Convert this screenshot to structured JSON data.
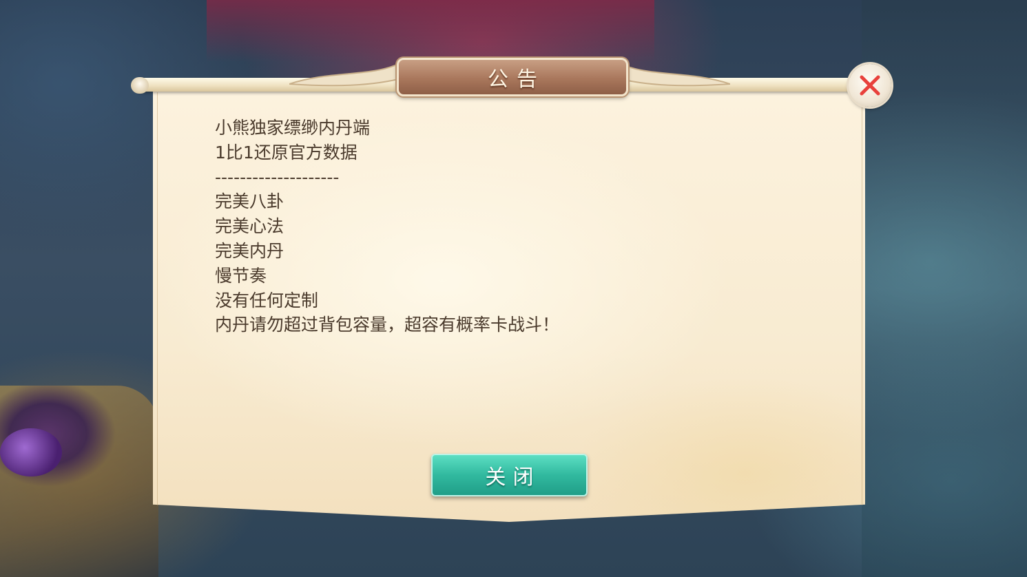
{
  "dialog": {
    "title": "公告",
    "close_icon": "close-x-icon",
    "lines": [
      "小熊独家缥缈内丹端",
      "1比1还原官方数据",
      "--------------------",
      "完美八卦",
      "完美心法",
      "完美内丹",
      "慢节奏",
      "没有任何定制",
      "内丹请勿超过背包容量，超容有概率卡战斗！"
    ],
    "close_button_label": "关闭"
  },
  "colors": {
    "panel": "#f8ebd1",
    "title_plaque": "#a9775c",
    "close_button": "#31b99f",
    "close_icon": "#e8413c",
    "text": "#4a3a2c"
  }
}
